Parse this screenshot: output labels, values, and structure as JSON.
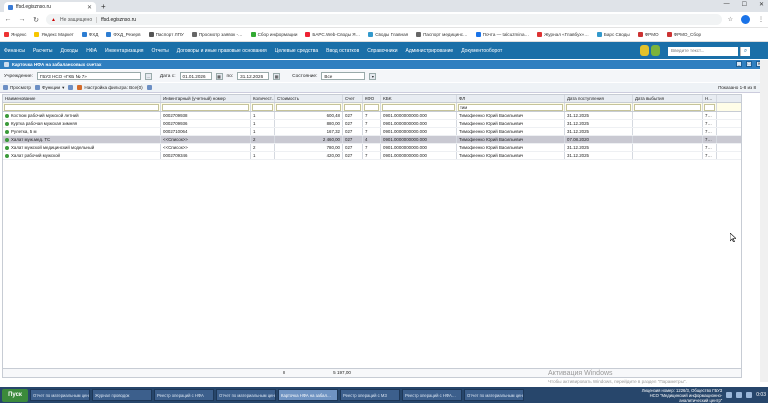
{
  "browser": {
    "tab_title": "ffsd.egisznso.ru",
    "security_label": "Не защищено",
    "url": "ffsd.egisznso.ru",
    "bookmarks": [
      {
        "label": "Яндекс",
        "color": "#e33"
      },
      {
        "label": "Яндекс Маркет",
        "color": "#f7c600"
      },
      {
        "label": "ФХД",
        "color": "#2d7dd2"
      },
      {
        "label": "ФХД_Резерв",
        "color": "#2d7dd2"
      },
      {
        "label": "Паспорт ЛПУ",
        "color": "#555"
      },
      {
        "label": "Просмотр заявок -…",
        "color": "#666"
      },
      {
        "label": "Сбор информации",
        "color": "#3a3"
      },
      {
        "label": "БАРС.Web-Своды Я…",
        "color": "#e23"
      },
      {
        "label": "Своды Главная",
        "color": "#39c"
      },
      {
        "label": "Паспорт медицинс…",
        "color": "#666"
      },
      {
        "label": "Почта — talcuzmina…",
        "color": "#1a73e8"
      },
      {
        "label": "Журнал «Главбух»…",
        "color": "#d33"
      },
      {
        "label": "Барс Своды",
        "color": "#39c"
      },
      {
        "label": "ФРМО",
        "color": "#c33"
      },
      {
        "label": "ФРМО_Сбор",
        "color": "#c33"
      }
    ]
  },
  "menu": {
    "items": [
      "Финансы",
      "Расчеты",
      "Доходы",
      "НФА",
      "Инвентаризация",
      "Отчеты",
      "Договоры и иные правовые основания",
      "Целевые средства",
      "Ввод остатков",
      "Справочники",
      "Администрирование",
      "Документооборот"
    ],
    "search_placeholder": "Введите текст..."
  },
  "panel": {
    "title": "Карточка НФА на забалансовых счетах"
  },
  "filter": {
    "institution_label": "Учреждение:",
    "institution_value": "ГБУЗ НСО «ГКБ № 7»",
    "date_from_label": "Дата с:",
    "date_from": "01.01.2026",
    "date_to_label": "по:",
    "date_to": "31.12.2026",
    "state_label": "Состояние:",
    "state_value": "Все"
  },
  "toolbar": {
    "view": "Просмотр",
    "functions": "Функции",
    "filter_setup": "Настройка фильтра: Все(0)",
    "shown": "Показано 1-8 из 8"
  },
  "columns": [
    "Наименование",
    "Инвентарный (учетный) номер",
    "Количест…",
    "Стоимость",
    "Счет",
    "КФО",
    "KБK",
    "ФЛ",
    "Дата поступления",
    "Дата выбытия",
    "Н…"
  ],
  "filter_row": {
    "fl": "тим"
  },
  "rows": [
    {
      "name": "Костюм рабочий мужской летний",
      "inv": "0002709938",
      "qty": "1",
      "cost": "600,48",
      "acc": "027",
      "kfo": "7",
      "kbk": "0901.0000000000.000",
      "fl": "Тимофеенко Юрий Васильевич",
      "in": "31.12.2025",
      "out": "",
      "n": "7…",
      "sel": false
    },
    {
      "name": "Куртка рабочая мужская зимняя",
      "inv": "0002709936",
      "qty": "1",
      "cost": "880,00",
      "acc": "027",
      "kfo": "7",
      "kbk": "0901.0000000000.000",
      "fl": "Тимофеенко Юрий Васильевич",
      "in": "31.12.2025",
      "out": "",
      "n": "7…",
      "sel": false
    },
    {
      "name": "Рулетка, 5 м",
      "inv": "0002710064",
      "qty": "1",
      "cost": "167,32",
      "acc": "027",
      "kfo": "7",
      "kbk": "0901.0000000000.000",
      "fl": "Тимофеенко Юрий Васильевич",
      "in": "31.12.2025",
      "out": "",
      "n": "7…",
      "sel": false
    },
    {
      "name": "Халат муж.мед. ТС",
      "inv": "<<Список>>",
      "qty": "2",
      "cost": "2 460,00",
      "acc": "027",
      "kfo": "4",
      "kbk": "0901.0000000000.000",
      "fl": "Тимофеенко Юрий Васильевич",
      "in": "07.08.2020",
      "out": "",
      "n": "7…",
      "sel": true
    },
    {
      "name": "Халат мужской медицинский модельный",
      "inv": "<<Список>>",
      "qty": "2",
      "cost": "780,00",
      "acc": "027",
      "kfo": "7",
      "kbk": "0901.0000000000.000",
      "fl": "Тимофеенко Юрий Васильевич",
      "in": "31.12.2025",
      "out": "",
      "n": "7…",
      "sel": false
    },
    {
      "name": "Халат рабочий мужской",
      "inv": "0002709346",
      "qty": "1",
      "cost": "420,00",
      "acc": "027",
      "kfo": "7",
      "kbk": "0901.0000000000.000",
      "fl": "Тимофеенко Юрий Васильевич",
      "in": "31.12.2025",
      "out": "",
      "n": "7…",
      "sel": false
    }
  ],
  "totals": {
    "qty": "8",
    "cost": "5 197,00"
  },
  "watermark": {
    "title": "Активация Windows",
    "sub": "Чтобы активировать Windows, перейдите в раздел \"Параметры\"."
  },
  "taskbar": {
    "start": "Пуск",
    "tasks": [
      {
        "label": "Отчет по материальным ценн…",
        "active": false
      },
      {
        "label": "Журнал проводок",
        "active": false
      },
      {
        "label": "Реестр операций с НФА",
        "active": false
      },
      {
        "label": "Отчет по материальным ценн…",
        "active": false
      },
      {
        "label": "Карточка НФА на забал…",
        "active": true
      },
      {
        "label": "Реестр операций с МЗ",
        "active": false
      },
      {
        "label": "Реестр операций с НФА…",
        "active": false
      },
      {
        "label": "Отчет по материальным ценн…",
        "active": false
      }
    ],
    "tray_text": "Лицензия номер: 1226/3, Общество ГБУЗ НСО \"Медицинский информационно-аналитический центр\"",
    "time": "0:03"
  }
}
